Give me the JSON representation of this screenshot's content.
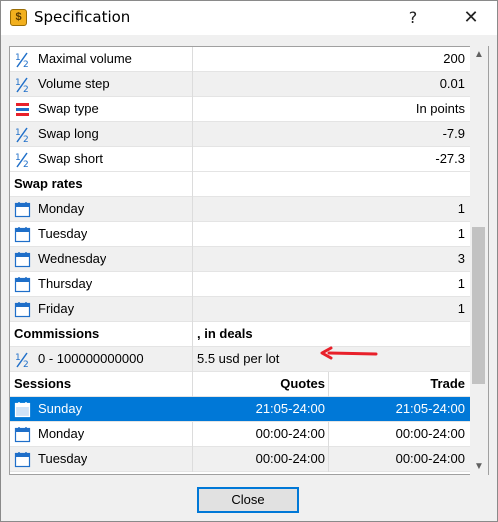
{
  "window": {
    "title": "Specification",
    "help_glyph": "?",
    "close_glyph": "✕",
    "app_icon_glyph": "$"
  },
  "rows": [
    {
      "name": "Maximal volume",
      "icon": "fraction-icon",
      "value": "200"
    },
    {
      "name": "Volume step",
      "icon": "fraction-icon",
      "value": "0.01"
    },
    {
      "name": "Swap type",
      "icon": "list-icon",
      "value": "In points"
    },
    {
      "name": "Swap long",
      "icon": "fraction-icon",
      "value": "-7.9"
    },
    {
      "name": "Swap short",
      "icon": "fraction-icon",
      "value": "-27.3"
    }
  ],
  "swap_rates": {
    "header": "Swap rates",
    "days": [
      {
        "name": "Monday",
        "value": "1"
      },
      {
        "name": "Tuesday",
        "value": "1"
      },
      {
        "name": "Wednesday",
        "value": "3"
      },
      {
        "name": "Thursday",
        "value": "1"
      },
      {
        "name": "Friday",
        "value": "1"
      }
    ]
  },
  "commissions": {
    "header": "Commissions",
    "header_value": ", in deals",
    "range": "0 - 100000000000",
    "value": "5.5 usd per lot"
  },
  "sessions": {
    "header": "Sessions",
    "col_quotes": "Quotes",
    "col_trade": "Trade",
    "rows": [
      {
        "day": "Sunday",
        "quotes": "21:05-24:00",
        "trade": "21:05-24:00",
        "selected": true
      },
      {
        "day": "Monday",
        "quotes": "00:00-24:00",
        "trade": "00:00-24:00",
        "selected": false
      },
      {
        "day": "Tuesday",
        "quotes": "00:00-24:00",
        "trade": "00:00-24:00",
        "selected": false
      }
    ]
  },
  "scrollbar": {
    "up_glyph": "▲",
    "down_glyph": "▼"
  },
  "buttons": {
    "close_label": "Close"
  },
  "colors": {
    "selection": "#0078d7",
    "annotation_arrow": "#e8202a",
    "icon_blue": "#1f6fc9"
  }
}
